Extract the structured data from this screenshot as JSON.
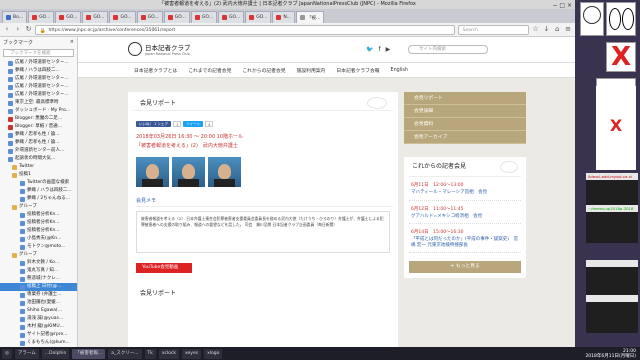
{
  "window": {
    "title": "「被害者報道を考える」(2) 武内大徳弁護士 | 日本記者クラブ JapanNationalPressClub (JNPC) - Mozilla Firefox",
    "controls": "− □ ×"
  },
  "tabs": [
    {
      "label": "Bo...",
      "active": false
    },
    {
      "label": "GO...",
      "active": false
    },
    {
      "label": "GO...",
      "active": false
    },
    {
      "label": "GO...",
      "active": false
    },
    {
      "label": "GO...",
      "active": false
    },
    {
      "label": "GO...",
      "active": false
    },
    {
      "label": "GO...",
      "active": false
    },
    {
      "label": "GO...",
      "active": false
    },
    {
      "label": "GO...",
      "active": false
    },
    {
      "label": "GO...",
      "active": false
    },
    {
      "label": "N...",
      "active": false
    },
    {
      "label": "「被...",
      "active": true
    }
  ],
  "navbar": {
    "url": "https://www.jnpc.or.jp/archive/conferences/35061/report",
    "search_placeholder": "Search"
  },
  "sidebar": {
    "title": "ブックマーク",
    "close": "×",
    "search_placeholder": "ブックマークを検索",
    "items": [
      {
        "label": "広尾 / 外環道新センター...",
        "icon": "bookmark"
      },
      {
        "label": "夢織 / ハラは四肢二...",
        "icon": "bookmark"
      },
      {
        "label": "広尾 / 外環道新センター...",
        "icon": "bookmark"
      },
      {
        "label": "広尾 / 外環道新センター...",
        "icon": "bookmark"
      },
      {
        "label": "広尾 / 外環道新センター...",
        "icon": "bookmark"
      },
      {
        "label": "東京上空: 最高標準時",
        "icon": "bookmark"
      },
      {
        "label": "ダッシュボード · My Pro...",
        "icon": "bookmark"
      },
      {
        "label": "Blogger: 悪魔の二足...",
        "icon": "red"
      },
      {
        "label": "Blogger: 草紙 / 普通...",
        "icon": "red"
      },
      {
        "label": "夢織 / 忠孝も性 / 論...",
        "icon": "bookmark"
      },
      {
        "label": "夢織 / 忠孝も性 / 論...",
        "icon": "bookmark"
      },
      {
        "label": "外環道新センター前人...",
        "icon": "bookmark"
      },
      {
        "label": "起訴状の時間大気...",
        "icon": "bookmark"
      },
      {
        "label": "Twitter",
        "icon": "folder"
      },
      {
        "label": "投稿1",
        "icon": "folder"
      },
      {
        "label": "Twitterの画面な検索",
        "icon": "bookmark"
      },
      {
        "label": "夢織 / ハラは四肢二...",
        "icon": "bookmark"
      },
      {
        "label": "夢織 / 2ちゃんねる...",
        "icon": "bookmark"
      },
      {
        "label": "グループ",
        "icon": "folder"
      },
      {
        "label": "投稿者分析Kn...",
        "icon": "bookmark"
      },
      {
        "label": "投稿者分析Kn...",
        "icon": "bookmark"
      },
      {
        "label": "投稿者分析Kn...",
        "icon": "bookmark"
      },
      {
        "label": "小島秀夫(@Kn...",
        "icon": "bookmark"
      },
      {
        "label": "モトクン@moto...",
        "icon": "bookmark"
      },
      {
        "label": "グループ",
        "icon": "folder"
      },
      {
        "label": "鈴木文教 / Ko...",
        "icon": "bookmark"
      },
      {
        "label": "鬼丸写真 / 知...",
        "icon": "bookmark"
      },
      {
        "label": "慈悲城(ナクレ...",
        "icon": "bookmark"
      },
      {
        "label": "投稿上 日付(@...",
        "icon": "bookmark",
        "selected": true
      },
      {
        "label": "専業券 (弁護士...",
        "icon": "bookmark"
      },
      {
        "label": "池田鐵也(愛媛...",
        "icon": "bookmark"
      },
      {
        "label": "Shiho Egawa(...",
        "icon": "bookmark"
      },
      {
        "label": "湯浅 誠(@yuas...",
        "icon": "bookmark"
      },
      {
        "label": "木村 龍(@KIMU...",
        "icon": "bookmark"
      },
      {
        "label": "サイト記者@rpre...",
        "icon": "bookmark"
      },
      {
        "label": "くまもちん(@kum...",
        "icon": "bookmark"
      },
      {
        "label": "ASHDOD(@c2c...",
        "icon": "bookmark"
      }
    ]
  },
  "site": {
    "logo_jp": "日本記者クラブ",
    "logo_en": "Japan National Press Club",
    "search_placeholder": "サイト内検索",
    "nav": [
      "日本記者クラブとは",
      "これまでの記者会見",
      "これからの記者会見",
      "施設利用案内",
      "日本記者クラブ会報",
      "English"
    ]
  },
  "report": {
    "section_title": "会見リポート",
    "share_like": "いいね！ 1 シェア",
    "share_like_count": "1",
    "share_tweet": "ツイート",
    "share_tweet_count": "4",
    "date": "2018年03月26日 16:30 ～ 20:00 10階ホール",
    "event": "「被害者報道を考える」(2)　武内大徳弁護士",
    "memo_title": "会見メモ",
    "memo_text": "被害者報道を考える（2） 日本弁護士連合会犯罪被害者支援委員会委員長を務める武内大徳（たけうち・ひろのり）弁護士が、弁護士による犯罪被害者への支援の取り組み、報道への要望などを話した。 司会　瀬川至朗 日本記者クラブ企画委員（毎日新聞）",
    "youtube": "YouTube会見動画",
    "section_title2": "会見リポート"
  },
  "right": {
    "menu": [
      "会見リポート",
      "会見詳細",
      "会見資料",
      "会見アーカイブ"
    ],
    "upcoming_title": "これからの記者会見",
    "upcoming": [
      {
        "date": "6月11日　12:00～13:00",
        "title": "マハティール・マレーシア首相　会見"
      },
      {
        "date": "6月12日　11:00～11:45",
        "title": "グアハルド=メキシコ経済相　会見"
      },
      {
        "date": "6月14日　15:00～16:30",
        "title": "「平成とは何だったのか」(平成の事件・疑獄史)　宮嶋 宏一 元東京地検特捜部長"
      }
    ],
    "more": "+ もっと見る"
  },
  "desktop": {
    "term1_label": "/bless\\-add-mysql-ca.vi",
    "term2_label": "~/memo-sp2018a-2018",
    "x_mark": "X"
  },
  "taskbar": {
    "items": [
      "アラーム",
      "...Dolphin",
      "「被害者報...",
      "a_スクリー...",
      "Tk",
      "xclock",
      "xeyes",
      "xlogo"
    ],
    "time": "21:00",
    "date": "2018年6月11日(月曜日)"
  }
}
